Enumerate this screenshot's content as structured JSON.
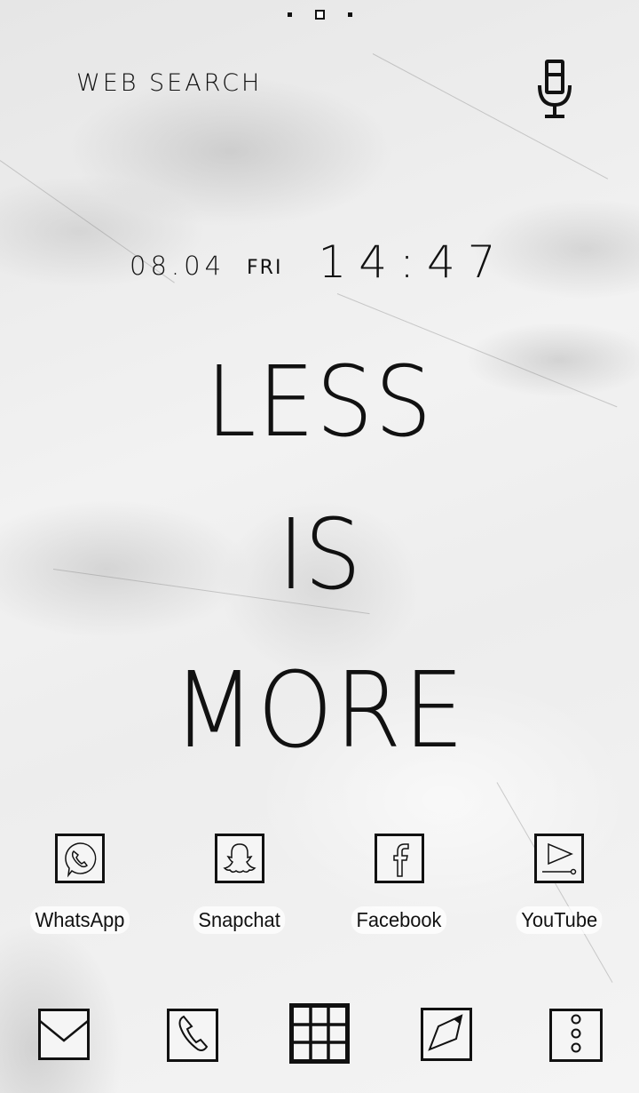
{
  "page_indicator": {
    "pages": 3,
    "current": 2
  },
  "search": {
    "label": "WEB SEARCH",
    "mic_icon": "microphone-icon"
  },
  "clock": {
    "date": "08.04",
    "day": "FRI",
    "time": "14:47"
  },
  "slogan": [
    "LESS",
    "IS",
    "MORE"
  ],
  "apps": [
    {
      "label": "WhatsApp",
      "icon": "whatsapp-icon"
    },
    {
      "label": "Snapchat",
      "icon": "snapchat-icon"
    },
    {
      "label": "Facebook",
      "icon": "facebook-icon"
    },
    {
      "label": "YouTube",
      "icon": "youtube-icon"
    }
  ],
  "dock": [
    {
      "name": "messages",
      "icon": "envelope-icon"
    },
    {
      "name": "phone",
      "icon": "phone-icon"
    },
    {
      "name": "app-drawer",
      "icon": "grid-icon"
    },
    {
      "name": "browser",
      "icon": "compass-icon"
    },
    {
      "name": "menu",
      "icon": "more-vertical-icon"
    }
  ],
  "colors": {
    "ink": "#111111",
    "background": "#ececec",
    "icon_fill": "#f5f5f5"
  }
}
